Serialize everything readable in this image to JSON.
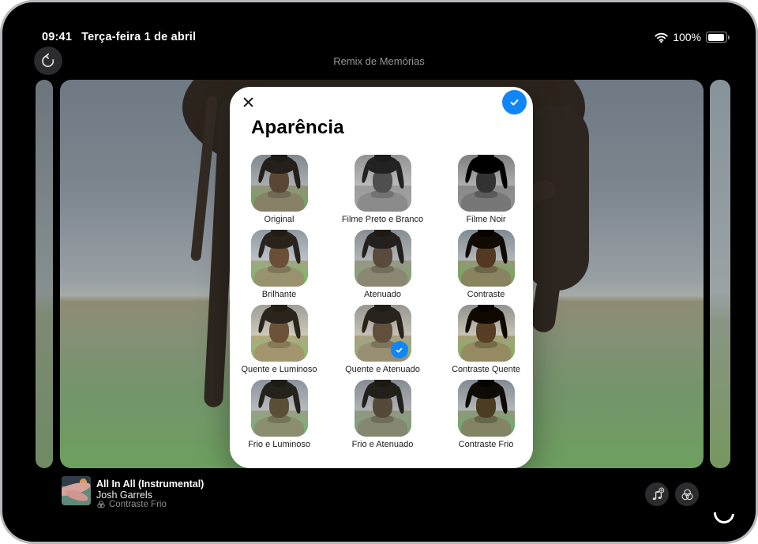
{
  "status_bar": {
    "time": "09:41",
    "date": "Terça-feira 1 de abril",
    "battery_percent": "100%"
  },
  "nav": {
    "title": "Remix de Memórias"
  },
  "modal": {
    "title": "Aparência",
    "filters": [
      {
        "id": "original",
        "label": "Original",
        "selected": false,
        "css_filter": "none"
      },
      {
        "id": "filme-preto-e-branco",
        "label": "Filme Preto e Branco",
        "selected": false,
        "css_filter": "grayscale(1) brightness(1.08)"
      },
      {
        "id": "filme-noir",
        "label": "Filme Noir",
        "selected": false,
        "css_filter": "grayscale(1) contrast(1.35) brightness(0.92)"
      },
      {
        "id": "brilhante",
        "label": "Brilhante",
        "selected": false,
        "css_filter": "brightness(1.12) saturate(1.2)"
      },
      {
        "id": "atenuado",
        "label": "Atenuado",
        "selected": false,
        "css_filter": "saturate(0.75) brightness(1.04)"
      },
      {
        "id": "contraste",
        "label": "Contraste",
        "selected": false,
        "css_filter": "contrast(1.22) saturate(1.05)"
      },
      {
        "id": "quente-e-luminoso",
        "label": "Quente e Luminoso",
        "selected": false,
        "css_filter": "sepia(0.28) saturate(1.25) brightness(1.1)"
      },
      {
        "id": "quente-e-atenuado",
        "label": "Quente e Atenuado",
        "selected": true,
        "css_filter": "sepia(0.3) saturate(0.95) brightness(1.05)"
      },
      {
        "id": "contraste-quente",
        "label": "Contraste Quente",
        "selected": false,
        "css_filter": "sepia(0.25) contrast(1.25) saturate(1.1)"
      },
      {
        "id": "frio-e-luminoso",
        "label": "Frio e Luminoso",
        "selected": false,
        "css_filter": "hue-rotate(12deg) saturate(0.95) brightness(1.08)"
      },
      {
        "id": "frio-e-atenuado",
        "label": "Frio e Atenuado",
        "selected": false,
        "css_filter": "hue-rotate(12deg) saturate(0.75) brightness(1.03)"
      },
      {
        "id": "contraste-frio",
        "label": "Contraste Frio",
        "selected": false,
        "css_filter": "hue-rotate(12deg) contrast(1.22) saturate(0.9)"
      }
    ]
  },
  "now_playing": {
    "song": "All In All (Instrumental)",
    "artist": "Josh Garrels",
    "filter_label": "Contraste Frio"
  },
  "colors": {
    "accent_blue": "#1086f7",
    "modal_bg": "#ffffff",
    "screen_bg": "#000000",
    "device_frame": "#b7b7bc"
  }
}
